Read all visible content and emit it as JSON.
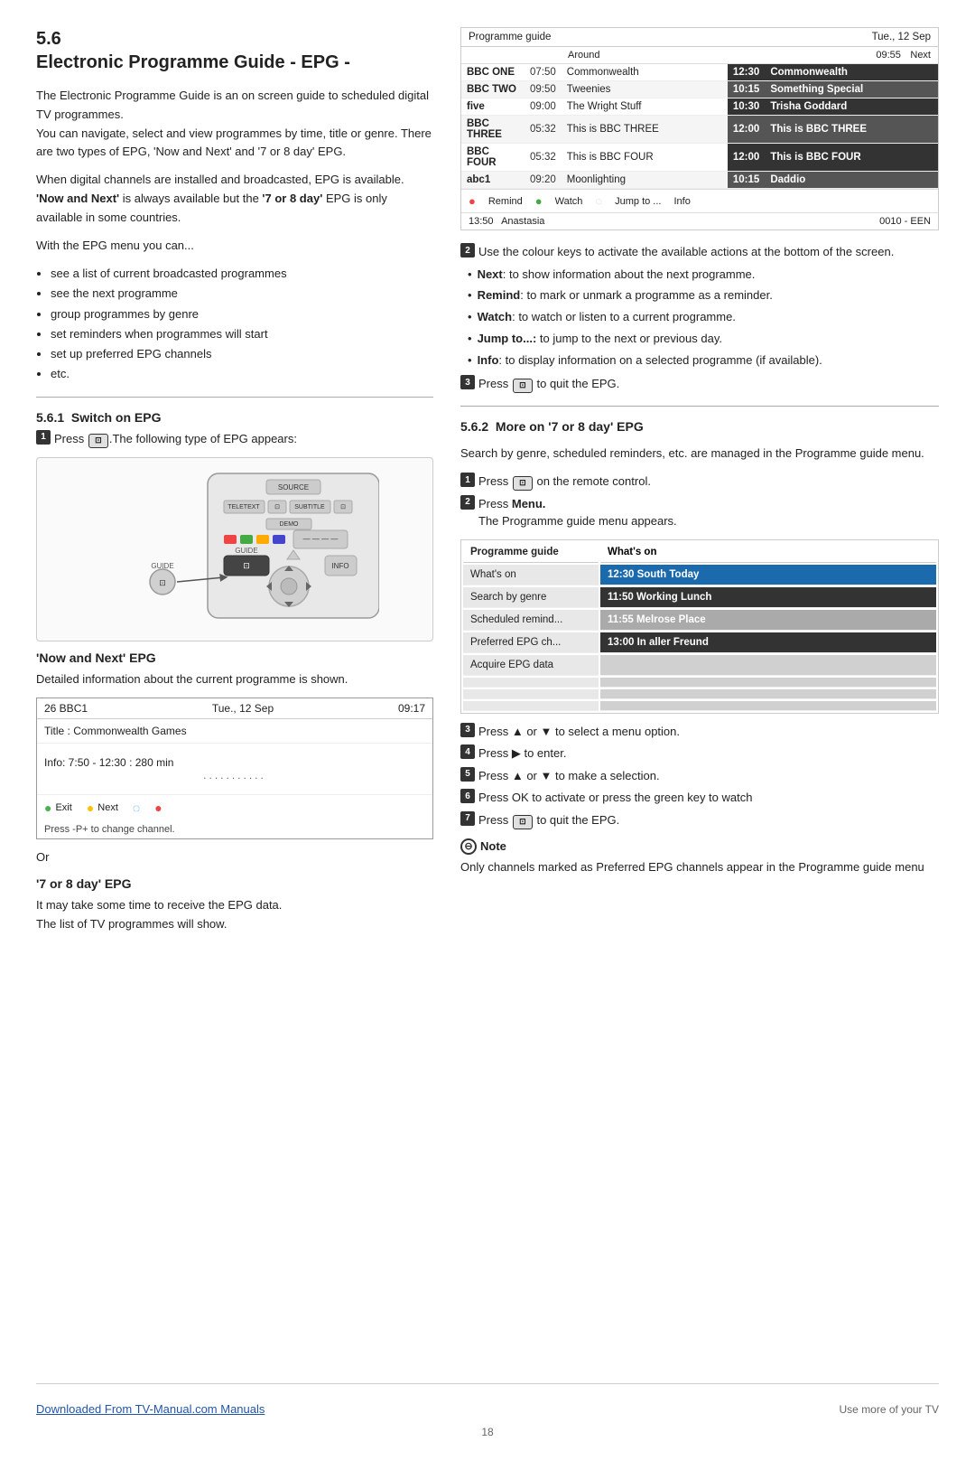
{
  "section": {
    "number": "5.6",
    "title": "Electronic Programme Guide - EPG -",
    "intro_p1": "The Electronic Programme Guide is an on screen guide to scheduled digital TV programmes.",
    "intro_p2": "You can navigate, select and view programmes by time, title or genre. There are two types of EPG, 'Now and Next' and '7 or 8 day' EPG.",
    "intro_p3": "When digital channels are installed and broadcasted, EPG is available.",
    "intro_bold1": "'Now and Next'",
    "intro_p3b": "is always available but the",
    "intro_bold2": "'7 or 8 day'",
    "intro_p3c": "EPG is only available in some countries.",
    "intro_p4": "With the EPG menu you can...",
    "bullet_items": [
      "see a list of current broadcasted programmes",
      "see the next programme",
      "group programmes by genre",
      "set reminders when programmes will start",
      "set up preferred EPG channels",
      "etc."
    ]
  },
  "sub561": {
    "number": "5.6.1",
    "title": "Switch on EPG",
    "step1": "Press",
    "step1b": ".The following type of EPG appears:"
  },
  "now_next": {
    "title": "'Now and Next' EPG",
    "desc": "Detailed information about the current programme is shown.",
    "box": {
      "channel": "26 BBC1",
      "date": "Tue., 12 Sep",
      "time": "09:17",
      "title_label": "Title : Commonwealth Games",
      "info": "Info: 7:50 - 12:30 : 280 min",
      "dots": "...........",
      "footer_items": [
        {
          "icon": "green",
          "label": "Exit"
        },
        {
          "icon": "yellow",
          "label": "Next"
        },
        {
          "icon": "blue",
          "label": ""
        },
        {
          "icon": "red",
          "label": ""
        }
      ],
      "press_note": "Press -P+ to change channel."
    }
  },
  "or_label": "Or",
  "seven_day": {
    "title": "'7 or 8 day' EPG",
    "desc1": "It may take some time to receive the EPG data.",
    "desc2": "The list of TV programmes will show."
  },
  "prog_guide_top": {
    "label": "Programme guide",
    "date": "Tue., 12 Sep",
    "col_around": "Around",
    "col_time": "09:55",
    "col_next": "Next",
    "rows": [
      {
        "chan": "BBC ONE",
        "time": "07:50",
        "around": "Commonwealth",
        "ntime": "12:30",
        "next": "Commonwealth"
      },
      {
        "chan": "BBC TWO",
        "time": "09:50",
        "around": "Tweenies",
        "ntime": "10:15",
        "next": "Something Special"
      },
      {
        "chan": "five",
        "time": "09:00",
        "around": "The Wright Stuff",
        "ntime": "10:30",
        "next": "Trisha Goddard"
      },
      {
        "chan": "BBC THREE",
        "time": "05:32",
        "around": "This is BBC THREE",
        "ntime": "12:00",
        "next": "This is BBC THREE"
      },
      {
        "chan": "BBC FOUR",
        "time": "05:32",
        "around": "This is BBC FOUR",
        "ntime": "12:00",
        "next": "This is BBC FOUR"
      },
      {
        "chan": "abc1",
        "time": "09:20",
        "around": "Moonlighting",
        "ntime": "10:15",
        "next": "Daddio"
      }
    ],
    "footer_remind": "Remind",
    "footer_watch": "Watch",
    "footer_jump": "Jump to ...",
    "footer_info": "Info",
    "footer_time": "13:50",
    "footer_channel": "Anastasia",
    "footer_code": "0010 - EEN"
  },
  "right_steps": [
    {
      "num": "2",
      "text": "Use the colour keys to activate the available actions at the bottom of the screen."
    }
  ],
  "right_bullets": [
    {
      "label": "Next",
      "desc": ": to show information about the next programme."
    },
    {
      "label": "Remind",
      "desc": ": to mark or unmark a programme as a reminder."
    },
    {
      "label": "Watch",
      "desc": ": to watch or listen to a current programme."
    },
    {
      "label": "Jump to...:",
      "desc": " to jump to the next or previous day."
    },
    {
      "label": "Info",
      "desc": ": to display information on a selected programme (if available)."
    }
  ],
  "step3_quit": "Press",
  "step3_quit2": "to quit the EPG.",
  "sub562": {
    "number": "5.6.2",
    "title": "More on '7 or 8 day' EPG",
    "desc": "Search by genre, scheduled reminders, etc. are managed in the Programme guide menu.",
    "step1": "Press",
    "step1b": "on the remote control.",
    "step2": "Press",
    "step2b": "Menu.",
    "step2c": "The Programme guide menu appears."
  },
  "whats_on_table": {
    "header_left": "Programme guide",
    "header_right": "What's on",
    "rows": [
      {
        "label": "What's on",
        "value": "12:30 South Today",
        "type": "active"
      },
      {
        "label": "Search by genre",
        "value": "11:50 Working Lunch",
        "type": "normal"
      },
      {
        "label": "Scheduled remind...",
        "value": "11:55 Melrose Place",
        "type": "light"
      },
      {
        "label": "Preferred EPG ch...",
        "value": "13:00 In aller Freund",
        "type": "normal"
      },
      {
        "label": "Acquire EPG data",
        "value": "",
        "type": "empty"
      },
      {
        "label": "",
        "value": "",
        "type": "empty"
      },
      {
        "label": "",
        "value": "",
        "type": "empty"
      },
      {
        "label": "",
        "value": "",
        "type": "empty"
      }
    ]
  },
  "bottom_steps": [
    {
      "num": "3",
      "text": "Press ▲ or ▼ to select a menu option."
    },
    {
      "num": "4",
      "text": "Press ▶ to enter."
    },
    {
      "num": "5",
      "text": "Press ▲ or ▼ to make a selection."
    },
    {
      "num": "6",
      "text": "Press OK to activate or press the green key to watch"
    },
    {
      "num": "7",
      "text": "Press    to quit the EPG."
    }
  ],
  "note": {
    "title": "Note",
    "text": "Only channels marked as Preferred EPG channels appear in the Programme guide menu"
  },
  "footer": {
    "link_text": "Downloaded From TV-Manual.com Manuals",
    "right_text": "Use more of your TV",
    "page_num": "18"
  }
}
